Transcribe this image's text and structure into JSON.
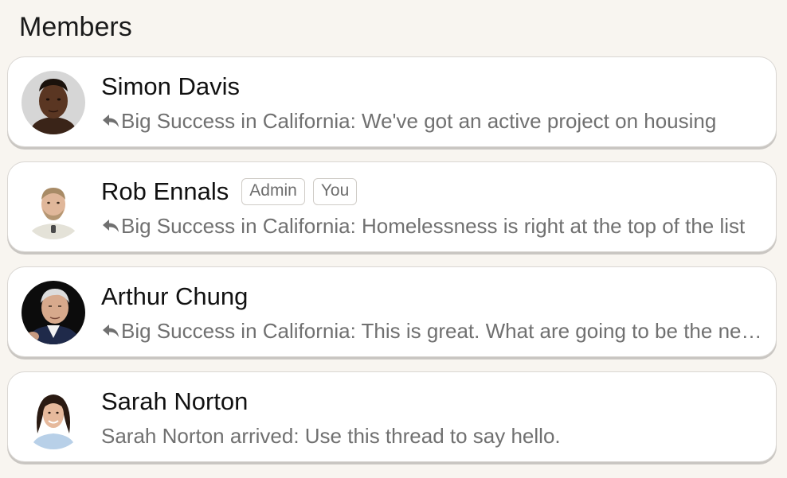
{
  "section": {
    "title": "Members"
  },
  "members": [
    {
      "name": "Simon Davis",
      "avatar_icon": "avatar-photo-simon-davis",
      "badges": [],
      "has_reply_icon": true,
      "last_message": "Big Success in California: We've got an active project on housing"
    },
    {
      "name": "Rob Ennals",
      "avatar_icon": "avatar-photo-rob-ennals",
      "badges": [
        "Admin",
        "You"
      ],
      "has_reply_icon": true,
      "last_message": "Big Success in California: Homelessness is right at the top of the list"
    },
    {
      "name": "Arthur Chung",
      "avatar_icon": "avatar-photo-arthur-chung",
      "badges": [],
      "has_reply_icon": true,
      "last_message": "Big Success in California: This is great. What are going to be the next steps"
    },
    {
      "name": "Sarah Norton",
      "avatar_icon": "avatar-photo-sarah-norton",
      "badges": [],
      "has_reply_icon": false,
      "last_message": "Sarah Norton arrived: Use this thread to say hello."
    }
  ],
  "colors": {
    "page_background": "#f8f5f0",
    "card_background": "#ffffff",
    "card_border": "#d9d6d2",
    "secondary_text": "#707070",
    "badge_border": "#cfcbc6"
  }
}
